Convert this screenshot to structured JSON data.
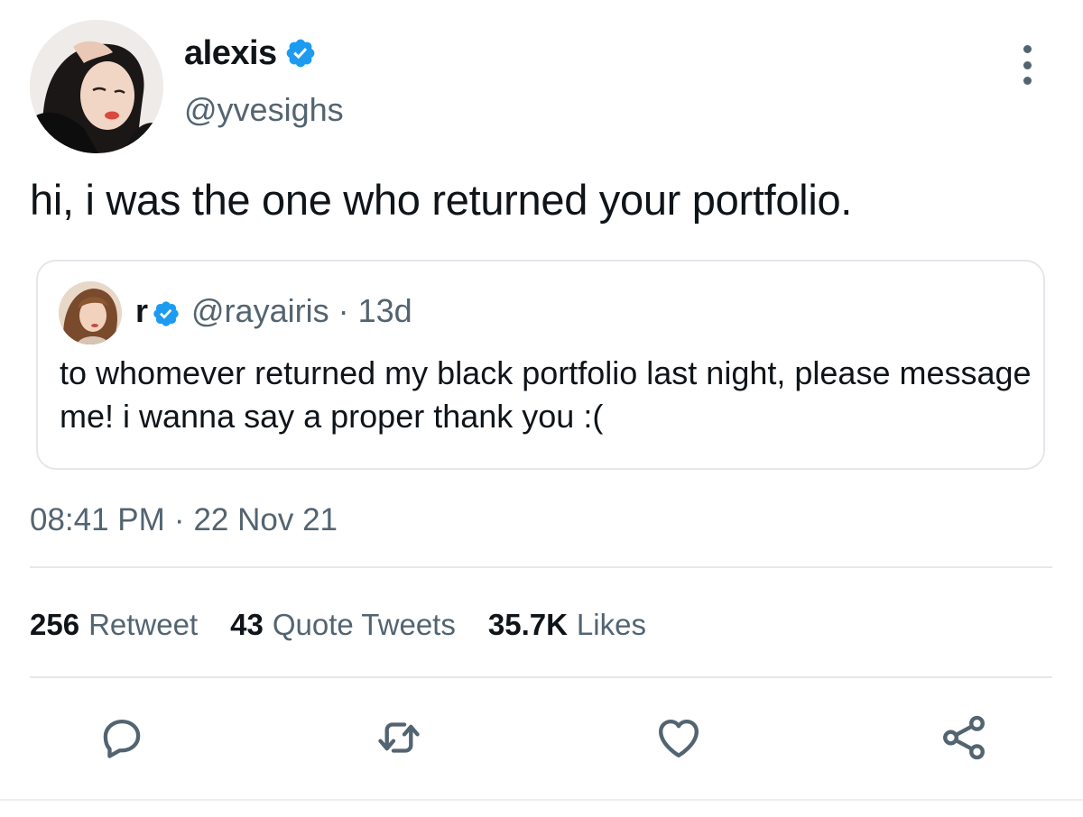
{
  "author": {
    "name": "alexis",
    "handle": "@yvesighs",
    "verified": true
  },
  "tweet": {
    "text": "hi, i was the one who returned your portfolio."
  },
  "quoted_tweet": {
    "name": "r",
    "handle": "@rayairis",
    "separator": "·",
    "age": "13d",
    "text": "to whomever returned my black portfolio last night, please message me! i wanna say a proper thank you :("
  },
  "meta": {
    "time": "08:41 PM",
    "separator": "·",
    "date": "22 Nov 21"
  },
  "stats": {
    "retweets_count": "256",
    "retweets_label": "Retweet",
    "quotes_count": "43",
    "quotes_label": "Quote Tweets",
    "likes_count": "35.7K",
    "likes_label": "Likes"
  },
  "actions": {
    "reply_icon": "reply-icon",
    "retweet_icon": "retweet-icon",
    "like_icon": "heart-icon",
    "share_icon": "share-icon"
  },
  "colors": {
    "verified": "#1d9bf0",
    "secondary_text": "#536471",
    "primary_text": "#0f1419",
    "border": "#e3e7ea"
  }
}
